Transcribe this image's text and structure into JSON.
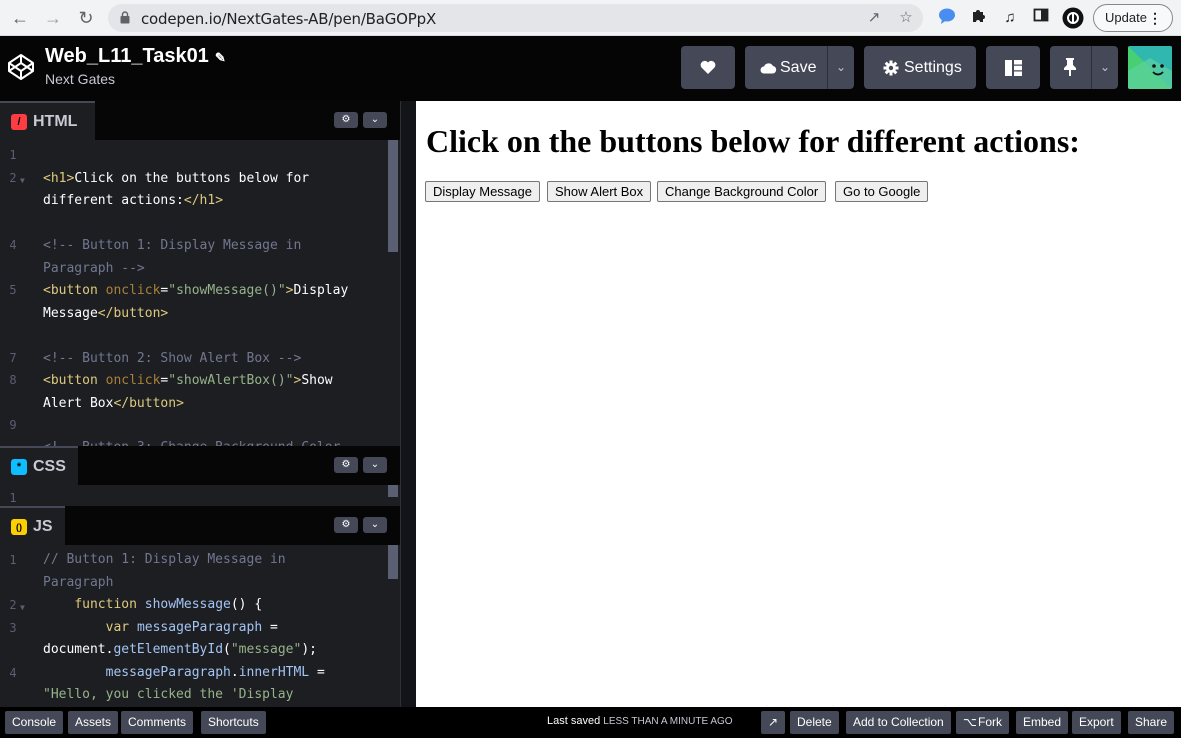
{
  "browser": {
    "url": "codepen.io/NextGates-AB/pen/BaGOPpX",
    "update_label": "Update"
  },
  "header": {
    "pen_title": "Web_L11_Task01",
    "owner": "Next Gates",
    "save_label": "Save",
    "settings_label": "Settings"
  },
  "editors": {
    "html": {
      "label": "HTML",
      "badge": "/",
      "color": "#ff3c41",
      "line_numbers": [
        "1",
        "2",
        "",
        "4",
        "",
        "5",
        "",
        "7",
        "8",
        "",
        "9"
      ]
    },
    "css": {
      "label": "CSS",
      "badge": "*",
      "color": "#0ebeff",
      "line_numbers": [
        "1"
      ]
    },
    "js": {
      "label": "JS",
      "badge": "()",
      "color": "#fcd000",
      "line_numbers": [
        "1",
        "",
        "2",
        "3",
        "",
        "4",
        ""
      ]
    }
  },
  "preview": {
    "heading": "Click on the buttons below for different actions:",
    "buttons": [
      "Display Message",
      "Show Alert Box",
      "Change Background Color",
      "Go to Google"
    ]
  },
  "footer": {
    "left_buttons": [
      "Console",
      "Assets",
      "Comments",
      "Shortcuts"
    ],
    "saved_prefix": "Last saved",
    "saved_when": "less than a minute ago",
    "right_buttons": [
      "Delete",
      "Add to Collection",
      "Fork",
      "Embed",
      "Export",
      "Share"
    ]
  }
}
